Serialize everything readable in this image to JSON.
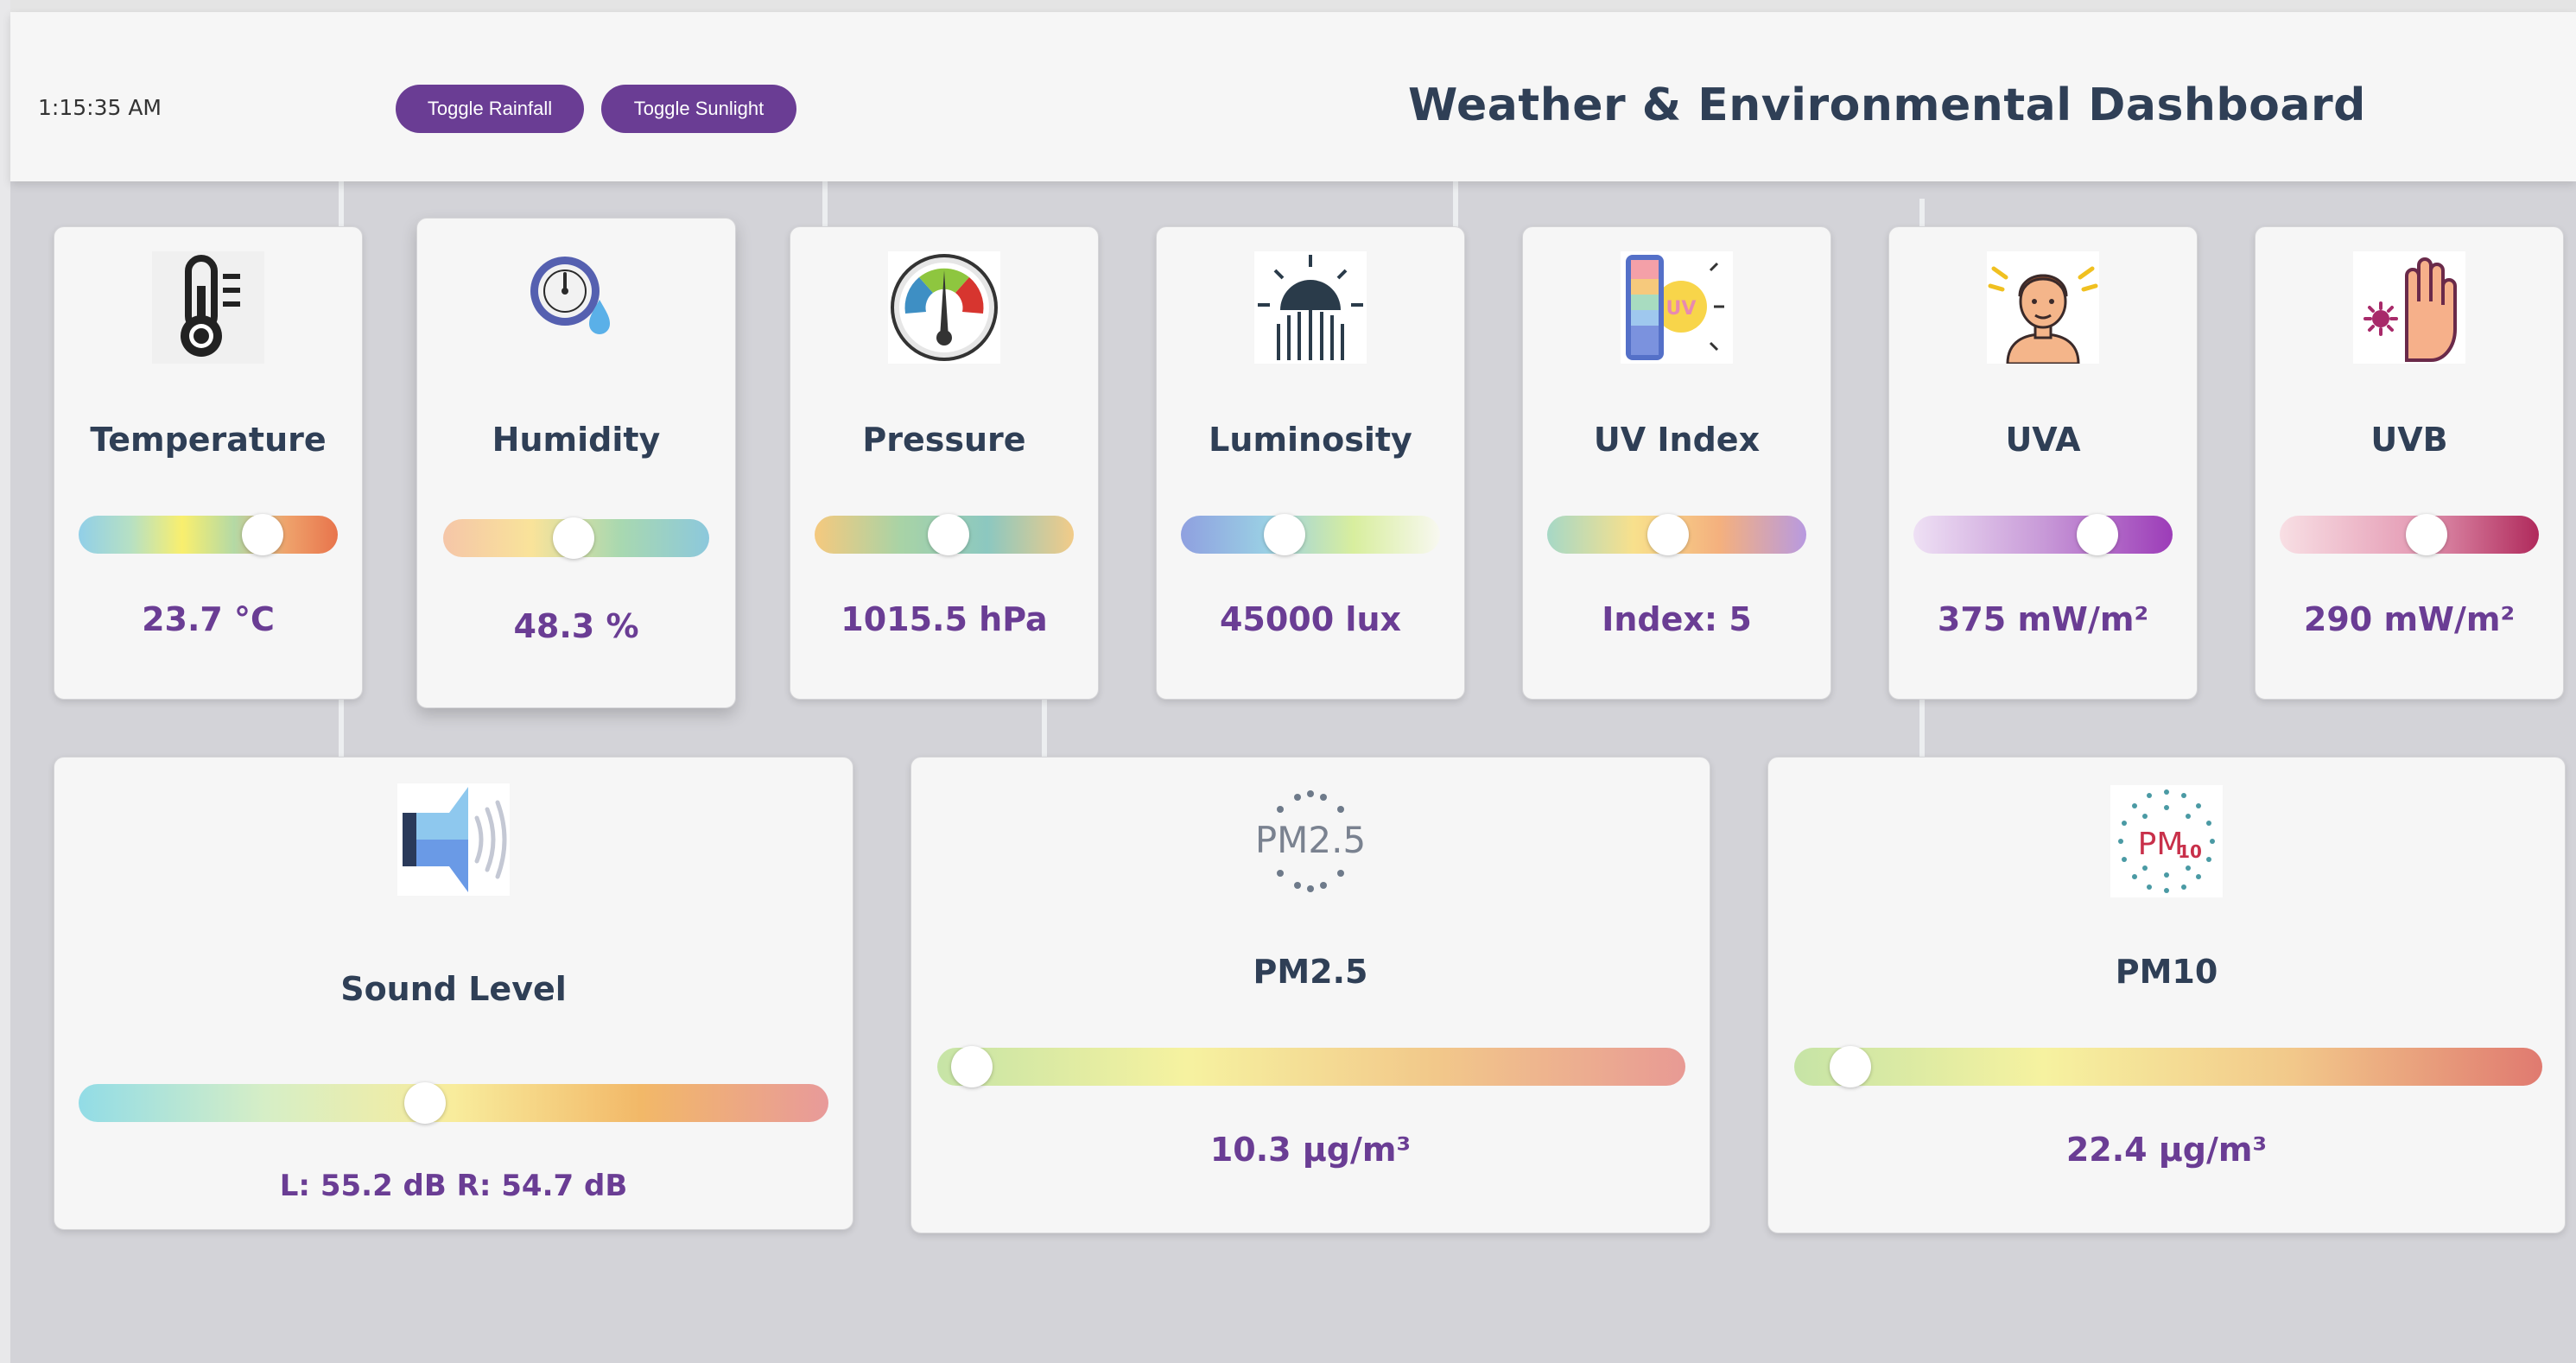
{
  "header": {
    "time": "1:15:35 AM",
    "buttons": {
      "rainfall": "Toggle Rainfall",
      "sunlight": "Toggle Sunlight"
    },
    "title": "Weather & Environmental Dashboard"
  },
  "colors": {
    "accent": "#6a3d94",
    "title": "#2f3f56",
    "card_bg": "#f6f6f6"
  },
  "sensors": {
    "temperature": {
      "label": "Temperature",
      "value": "23.7 °C",
      "level": 0.75,
      "icon": "thermometer-icon"
    },
    "humidity": {
      "label": "Humidity",
      "value": "48.3 %",
      "level": 0.49,
      "icon": "hygrometer-icon"
    },
    "pressure": {
      "label": "Pressure",
      "value": "1015.5 hPa",
      "level": 0.52,
      "icon": "gauge-icon"
    },
    "luminosity": {
      "label": "Luminosity",
      "value": "45000 lux",
      "level": 0.38,
      "icon": "sunrise-icon"
    },
    "uv_index": {
      "label": "UV Index",
      "value": "Index: 5",
      "level": 0.46,
      "icon": "uv-sun-icon"
    },
    "uva": {
      "label": "UVA",
      "value": "375 mW/m²",
      "level": 0.75,
      "icon": "sunburned-person-icon"
    },
    "uvb": {
      "label": "UVB",
      "value": "290 mW/m²",
      "level": 0.58,
      "icon": "skin-hand-icon"
    },
    "sound": {
      "label": "Sound Level",
      "value": "L: 55.2 dB R: 54.7 dB",
      "level": 0.46,
      "icon": "speaker-icon"
    },
    "pm25": {
      "label": "PM2.5",
      "value": "10.3 µg/m³",
      "level": 0.02,
      "icon": "pm25-icon",
      "icon_text": "PM2.5"
    },
    "pm10": {
      "label": "PM10",
      "value": "22.4 µg/m³",
      "level": 0.05,
      "icon": "pm10-icon",
      "icon_text": "PM",
      "icon_sub": "10"
    }
  }
}
